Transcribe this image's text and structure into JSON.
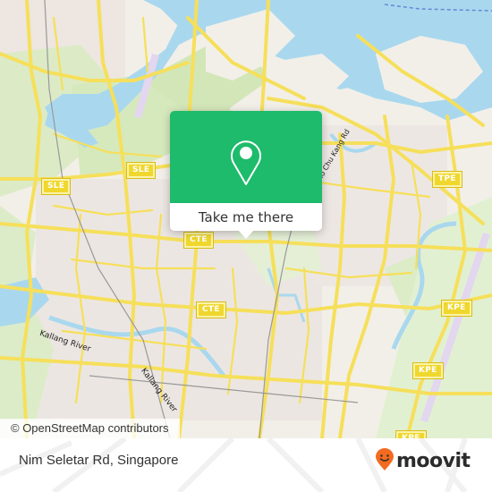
{
  "map": {
    "road_shields": [
      {
        "label": "SLE",
        "id": "sle-west"
      },
      {
        "label": "SLE",
        "id": "sle-center"
      },
      {
        "label": "CTE",
        "id": "cte-north"
      },
      {
        "label": "CTE",
        "id": "cte-south"
      },
      {
        "label": "TPE",
        "id": "tpe"
      },
      {
        "label": "KPE",
        "id": "kpe-north"
      },
      {
        "label": "KPE",
        "id": "kpe-south"
      },
      {
        "label": "KPE",
        "id": "kpe-bottom"
      }
    ],
    "water_labels": [
      "Kallang River",
      "Kallang River"
    ],
    "street_labels": [
      "Yio Chu Kang Rd"
    ],
    "attribution": "© OpenStreetMap contributors",
    "colors": {
      "land": "#f2efe9",
      "water": "#a9d8ee",
      "park": "#d8ebc0",
      "road": "#f6df5a",
      "runway": "#e3d6ef"
    }
  },
  "popup": {
    "icon": "map-pin-icon",
    "button_label": "Take me there",
    "accent_color": "#1dbb6b"
  },
  "footer": {
    "location_name": "Nim Seletar Rd, Singapore",
    "brand": "moovit",
    "brand_color": "#f26b21"
  }
}
